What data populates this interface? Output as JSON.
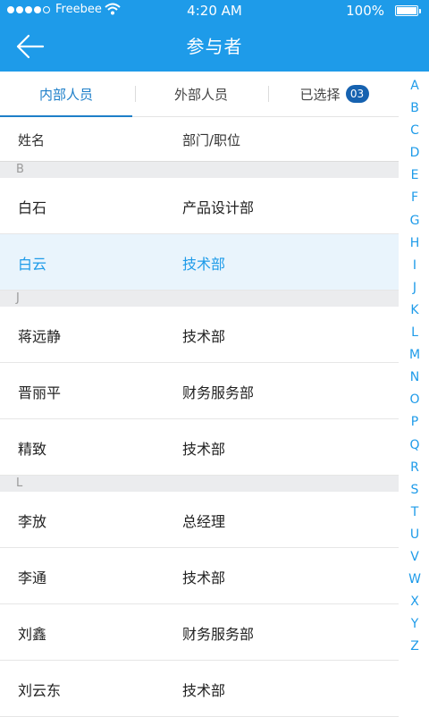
{
  "status_bar": {
    "carrier": "Freebee",
    "time": "4:20 AM",
    "battery": "100%"
  },
  "header": {
    "title": "参与者",
    "back_icon": "arrow-left-icon"
  },
  "tabs": [
    {
      "label": "内部人员",
      "active": true
    },
    {
      "label": "外部人员",
      "active": false
    },
    {
      "label": "已选择",
      "badge": "03",
      "active": false
    }
  ],
  "columns": {
    "name": "姓名",
    "dept": "部门/职位"
  },
  "sections": [
    {
      "letter": "B",
      "rows": [
        {
          "name": "白石",
          "dept": "产品设计部",
          "selected": false
        },
        {
          "name": "白云",
          "dept": "技术部",
          "selected": true
        }
      ]
    },
    {
      "letter": "J",
      "rows": [
        {
          "name": "蒋远静",
          "dept": "技术部",
          "selected": false
        },
        {
          "name": "晋丽平",
          "dept": "财务服务部",
          "selected": false
        },
        {
          "name": "精致",
          "dept": "技术部",
          "selected": false
        }
      ]
    },
    {
      "letter": "L",
      "rows": [
        {
          "name": "李放",
          "dept": "总经理",
          "selected": false
        },
        {
          "name": "李通",
          "dept": "技术部",
          "selected": false
        },
        {
          "name": "刘鑫",
          "dept": "财务服务部",
          "selected": false
        },
        {
          "name": "刘云东",
          "dept": "技术部",
          "selected": false
        }
      ]
    }
  ],
  "index_letters": [
    "A",
    "B",
    "C",
    "D",
    "E",
    "F",
    "G",
    "H",
    "I",
    "J",
    "K",
    "L",
    "M",
    "N",
    "O",
    "P",
    "Q",
    "R",
    "S",
    "T",
    "U",
    "V",
    "W",
    "X",
    "Y",
    "Z"
  ],
  "colors": {
    "primary": "#1e9be9",
    "badge": "#1662b0",
    "selected_bg": "#e9f4fc",
    "section_bg": "#ebecee"
  }
}
